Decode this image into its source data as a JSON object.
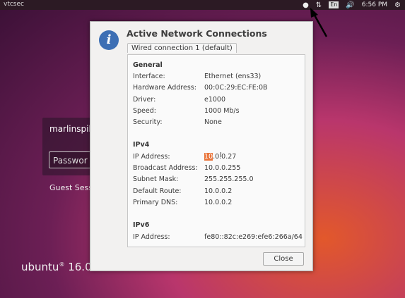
{
  "topbar": {
    "hostname": "vtcsec",
    "keyboard_layout": "En",
    "clock": "6:56 PM",
    "icons": [
      "accessibility-icon",
      "network-icon",
      "volume-icon",
      "gear-icon"
    ]
  },
  "login": {
    "username": "marlinspik",
    "password_placeholder": "Passwor",
    "guest_label": "Guest Sess",
    "brand": "ubuntu",
    "brand_version": "16.0"
  },
  "dialog": {
    "title": "Active Network Connections",
    "tab_label": "Wired connection 1 (default)",
    "general_heading": "General",
    "general": [
      {
        "key": "Interface:",
        "value": "Ethernet (ens33)"
      },
      {
        "key": "Hardware Address:",
        "value": "00:0C:29:EC:FE:0B"
      },
      {
        "key": "Driver:",
        "value": "e1000"
      },
      {
        "key": "Speed:",
        "value": "1000 Mb/s"
      },
      {
        "key": "Security:",
        "value": "None"
      }
    ],
    "ipv4_heading": "IPv4",
    "ipv4": {
      "ip_key": "IP Address:",
      "ip_selected": "10",
      "ip_rest": ".0.0.27",
      "rows": [
        {
          "key": "Broadcast Address:",
          "value": "10.0.0.255"
        },
        {
          "key": "Subnet Mask:",
          "value": "255.255.255.0"
        },
        {
          "key": "Default Route:",
          "value": "10.0.0.2"
        },
        {
          "key": "Primary DNS:",
          "value": "10.0.0.2"
        }
      ]
    },
    "ipv6_heading": "IPv6",
    "ipv6": {
      "key": "IP Address:",
      "value": "fe80::82c:e269:efe6:266a/64"
    },
    "close_label": "Close"
  },
  "colors": {
    "selection": "#e9743a",
    "info_icon": "#3d6fb4",
    "topbar": "#2c1a24"
  }
}
